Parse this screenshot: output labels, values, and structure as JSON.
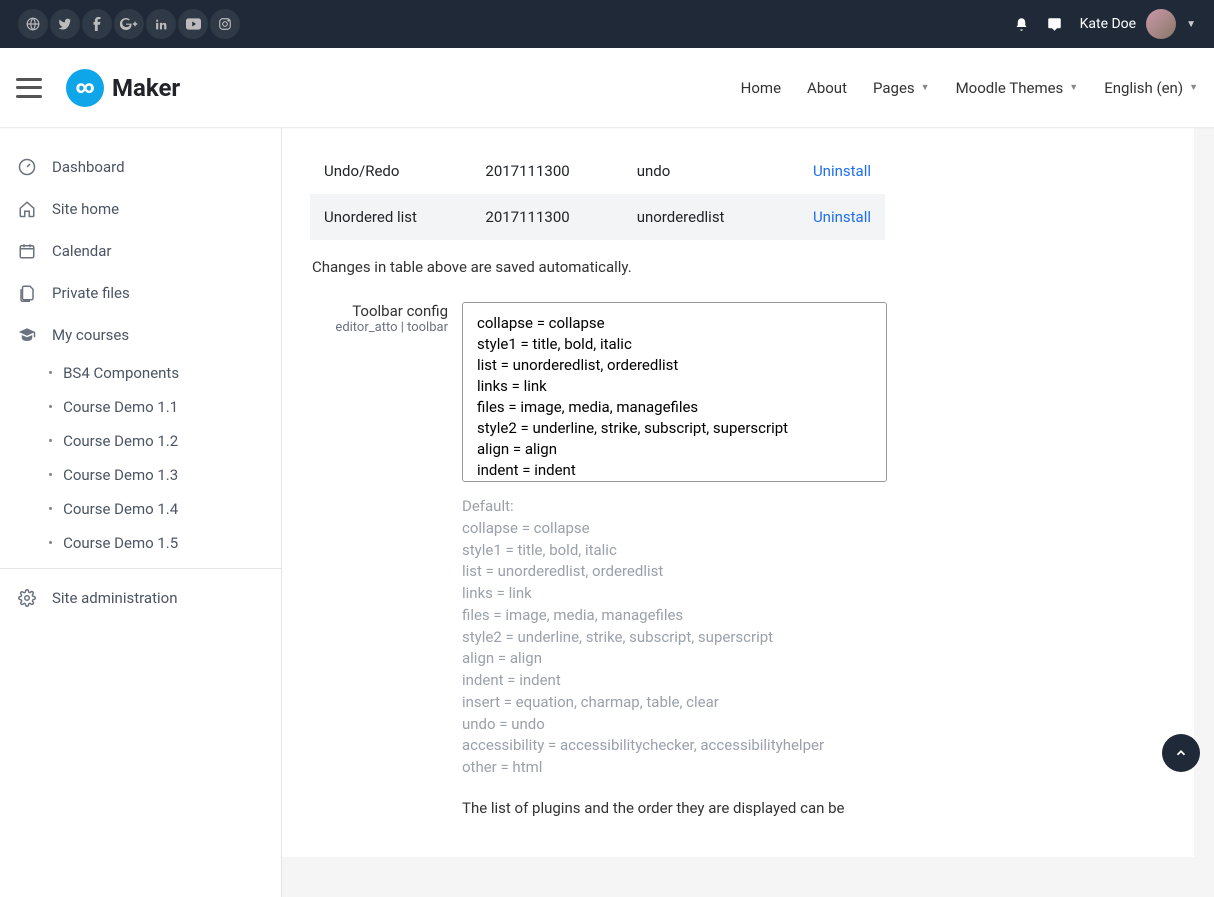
{
  "topbar": {
    "user_name": "Kate Doe"
  },
  "brand": {
    "name": "Maker",
    "logo_glyph": "∞"
  },
  "nav": {
    "items": [
      {
        "label": "Home",
        "dropdown": false
      },
      {
        "label": "About",
        "dropdown": false
      },
      {
        "label": "Pages",
        "dropdown": true
      },
      {
        "label": "Moodle Themes",
        "dropdown": true
      },
      {
        "label": "English (en)",
        "dropdown": true
      }
    ]
  },
  "sidebar": {
    "links": [
      {
        "label": "Dashboard",
        "icon": "dashboard"
      },
      {
        "label": "Site home",
        "icon": "home"
      },
      {
        "label": "Calendar",
        "icon": "calendar"
      },
      {
        "label": "Private files",
        "icon": "files"
      },
      {
        "label": "My courses",
        "icon": "grad-cap"
      }
    ],
    "courses": [
      {
        "label": "BS4 Components"
      },
      {
        "label": "Course Demo 1.1"
      },
      {
        "label": "Course Demo 1.2"
      },
      {
        "label": "Course Demo 1.3"
      },
      {
        "label": "Course Demo 1.4"
      },
      {
        "label": "Course Demo 1.5"
      }
    ],
    "admin_label": "Site administration"
  },
  "plugins_table": {
    "rows": [
      {
        "name": "Undo/Redo",
        "version": "2017111300",
        "slug": "undo",
        "action": "Uninstall"
      },
      {
        "name": "Unordered list",
        "version": "2017111300",
        "slug": "unorderedlist",
        "action": "Uninstall"
      }
    ]
  },
  "notice": "Changes in table above are saved automatically.",
  "toolbar_config": {
    "title": "Toolbar config",
    "subtitle": "editor_atto | toolbar",
    "value": "collapse = collapse\nstyle1 = title, bold, italic\nlist = unorderedlist, orderedlist\nlinks = link\nfiles = image, media, managefiles\nstyle2 = underline, strike, subscript, superscript\nalign = align\nindent = indent\ninsert = equation, charmap, table, clear"
  },
  "defaults": {
    "heading": "Default:",
    "lines": [
      "collapse = collapse",
      "style1 = title, bold, italic",
      "list = unorderedlist, orderedlist",
      "links = link",
      "files = image, media, managefiles",
      "style2 = underline, strike, subscript, superscript",
      "align = align",
      "indent = indent",
      "insert = equation, charmap, table, clear",
      "undo = undo",
      "accessibility = accessibilitychecker, accessibilityhelper",
      "other = html"
    ]
  },
  "bottom_hint": "The list of plugins and the order they are displayed can be"
}
